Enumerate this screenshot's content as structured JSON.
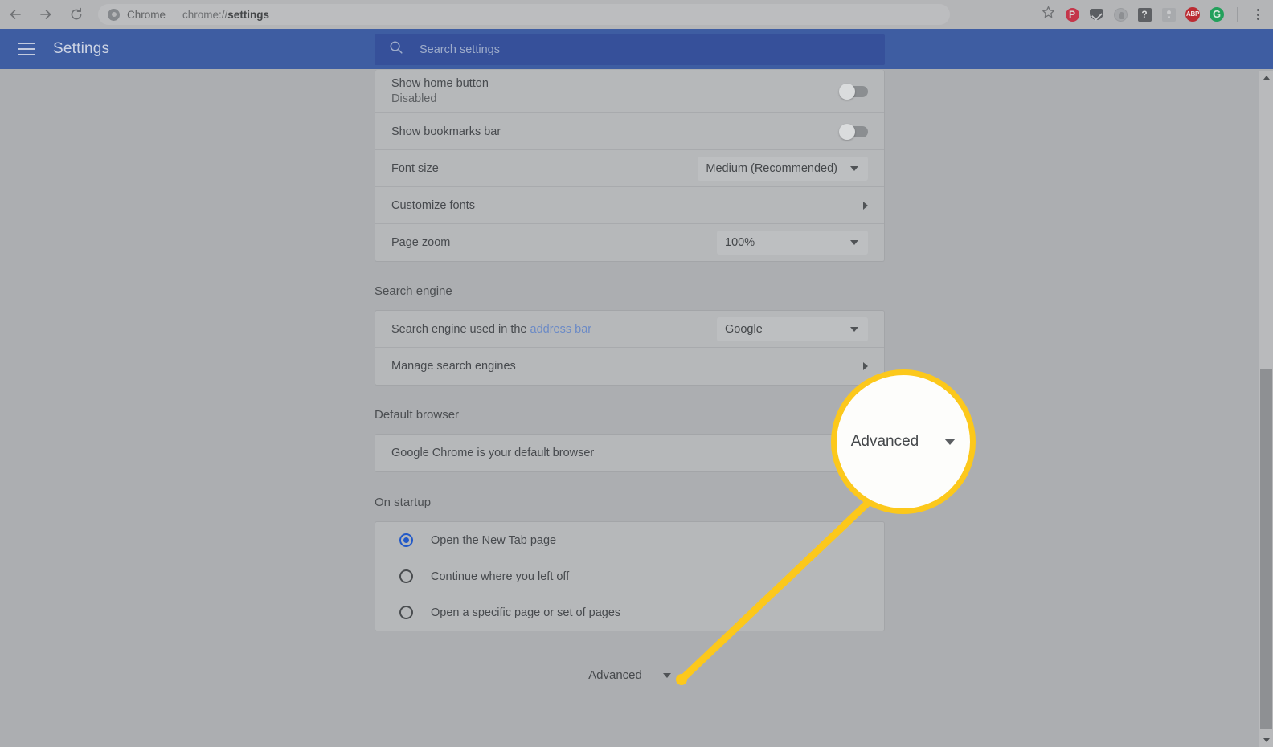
{
  "browser": {
    "back_icon": "back-arrow-icon",
    "forward_icon": "forward-arrow-icon",
    "reload_icon": "reload-icon",
    "omnibox_label": "Chrome",
    "omnibox_url_prefix": "chrome://",
    "omnibox_url_bold": "settings",
    "bookmark_icon": "star-icon",
    "extensions": [
      {
        "name": "pinterest-extension-icon",
        "glyph": "P"
      },
      {
        "name": "pocket-extension-icon",
        "glyph": ""
      },
      {
        "name": "lastpass-extension-icon",
        "glyph": ""
      },
      {
        "name": "help-extension-icon",
        "glyph": "?"
      },
      {
        "name": "person-extension-icon",
        "glyph": ""
      },
      {
        "name": "adblock-plus-extension-icon",
        "glyph": "ABP"
      },
      {
        "name": "grammarly-extension-icon",
        "glyph": "G"
      }
    ],
    "menu_icon": "three-dot-menu-icon"
  },
  "settings_header": {
    "menu_icon": "hamburger-menu-icon",
    "title": "Settings",
    "search_icon": "search-icon",
    "search_placeholder": "Search settings",
    "search_value": ""
  },
  "appearance": {
    "rows": [
      {
        "label": "Show home button",
        "sub": "Disabled",
        "control": "toggle",
        "state": "off"
      },
      {
        "label": "Show bookmarks bar",
        "sub": "",
        "control": "toggle",
        "state": "off"
      },
      {
        "label": "Font size",
        "sub": "",
        "control": "select",
        "value": "Medium (Recommended)"
      },
      {
        "label": "Customize fonts",
        "sub": "",
        "control": "arrow"
      },
      {
        "label": "Page zoom",
        "sub": "",
        "control": "select",
        "value": "100%"
      }
    ]
  },
  "search_engine": {
    "section_title": "Search engine",
    "row_label_prefix": "Search engine used in the ",
    "row_label_link": "address bar",
    "row_value": "Google",
    "manage_label": "Manage search engines"
  },
  "default_browser": {
    "section_title": "Default browser",
    "status": "Google Chrome is your default browser"
  },
  "on_startup": {
    "section_title": "On startup",
    "options": [
      {
        "label": "Open the New Tab page",
        "selected": true
      },
      {
        "label": "Continue where you left off",
        "selected": false
      },
      {
        "label": "Open a specific page or set of pages",
        "selected": false
      }
    ]
  },
  "advanced": {
    "label": "Advanced",
    "caret_icon": "chevron-down-icon"
  },
  "callout": {
    "magnified_label": "Advanced",
    "magnified_caret_icon": "chevron-down-icon",
    "highlight_color": "#fcc81b"
  },
  "scrollbar": {
    "up_arrow_icon": "scroll-up-arrow-icon",
    "down_arrow_icon": "scroll-down-arrow-icon"
  }
}
